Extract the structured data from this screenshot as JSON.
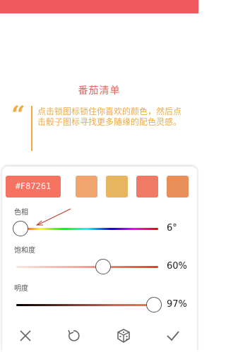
{
  "header": {
    "title": "番茄清单"
  },
  "quote": {
    "mark": "“",
    "text": "点击锁图标锁住你喜欢的颜色，然后点击骰子图标寻找更多随缘的配色灵感。"
  },
  "palette": {
    "hex": "#F87261",
    "main_color": "#f87261",
    "swatches": [
      "#f0a56f",
      "#e7b45f",
      "#ef7a66",
      "#e98f5a"
    ]
  },
  "sliders": [
    {
      "label": "色相",
      "value": "6°",
      "level": 0.017
    },
    {
      "label": "饱和度",
      "value": "60%",
      "level": 0.6
    },
    {
      "label": "明度",
      "value": "97%",
      "level": 0.97
    }
  ],
  "toolbar": {
    "cancel_icon": "close-icon",
    "reset_icon": "undo-icon",
    "random_icon": "dice-icon",
    "confirm_icon": "check-icon"
  },
  "colors": {
    "status_bar": "#f2585f",
    "title": "#e4655e",
    "quote": "#efaa45",
    "annotation_arrow": "#c0392b"
  }
}
